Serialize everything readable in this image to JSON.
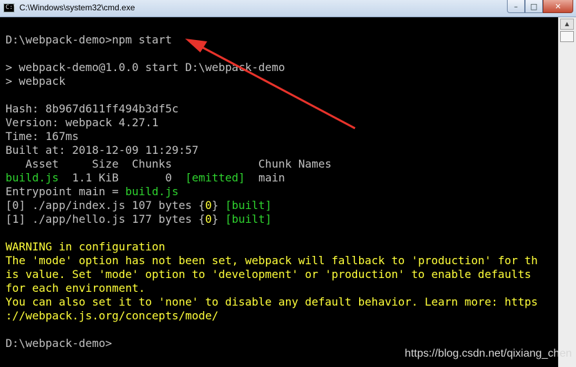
{
  "window": {
    "icon": "cmd-icon",
    "title": "C:\\Windows\\system32\\cmd.exe",
    "minimize": "–",
    "maximize": "□",
    "close": "✕"
  },
  "console": {
    "lines": [
      {
        "text": "D:\\webpack-demo>npm start",
        "color": "gray"
      },
      {
        "text": "",
        "color": "gray"
      },
      {
        "text": "> webpack-demo@1.0.0 start D:\\webpack-demo",
        "color": "gray"
      },
      {
        "text": "> webpack",
        "color": "gray"
      },
      {
        "text": "",
        "color": "gray"
      },
      {
        "text": "Hash: 8b967d611ff494b3df5c",
        "color": "gray"
      },
      {
        "text": "Version: webpack 4.27.1",
        "color": "gray"
      },
      {
        "text": "Time: 167ms",
        "color": "gray"
      },
      {
        "text": "Built at: 2018-12-09 11:29:57",
        "color": "gray"
      },
      {
        "text": "   Asset     Size  Chunks             Chunk Names",
        "color": "gray"
      },
      {
        "text": "build.js  1.1 KiB       0  [emitted]  main",
        "color": "mixed1"
      },
      {
        "text": "Entrypoint main = build.js",
        "color": "mixed2"
      },
      {
        "text": "[0] ./app/index.js 107 bytes {0} [built]",
        "color": "mixed3"
      },
      {
        "text": "[1] ./app/hello.js 177 bytes {0} [built]",
        "color": "mixed3"
      },
      {
        "text": "",
        "color": "gray"
      },
      {
        "text": "WARNING in configuration",
        "color": "yellow"
      },
      {
        "text": "The 'mode' option has not been set, webpack will fallback to 'production' for th",
        "color": "yellow"
      },
      {
        "text": "is value. Set 'mode' option to 'development' or 'production' to enable defaults",
        "color": "yellow"
      },
      {
        "text": "for each environment.",
        "color": "yellow"
      },
      {
        "text": "You can also set it to 'none' to disable any default behavior. Learn more: https",
        "color": "yellow"
      },
      {
        "text": "://webpack.js.org/concepts/mode/",
        "color": "yellow"
      },
      {
        "text": "",
        "color": "gray"
      },
      {
        "text": "D:\\webpack-demo>",
        "color": "gray"
      }
    ],
    "segments": {
      "build_js": "build.js",
      "asset_rest": "  1.1 KiB       0  ",
      "emitted": "[emitted]",
      "main_name": "  main",
      "entry_prefix": "Entrypoint main = ",
      "entry_file": "build.js",
      "mod0_prefix": "[0] ./app/index.js 107 bytes {",
      "mod1_prefix": "[1] ./app/hello.js 177 bytes {",
      "chunk_id": "0",
      "mod_mid": "} ",
      "built": "[built]"
    }
  },
  "colors": {
    "gray": "#c0c0c0",
    "yellow": "#ffff3a",
    "green": "#2ed12e",
    "annotation_arrow": "#e8332b"
  },
  "scrollbar": {
    "up_arrow": "▲"
  },
  "watermark": "https://blog.csdn.net/qixiang_chen"
}
